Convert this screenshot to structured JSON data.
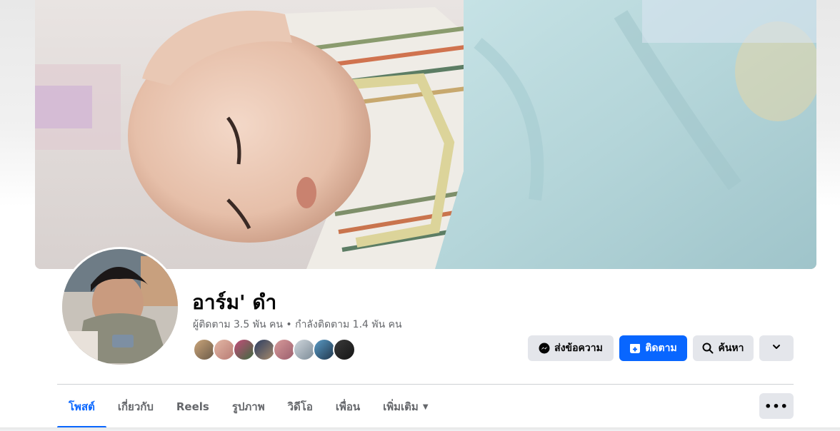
{
  "profile": {
    "name": "อาร์ม' ดำ",
    "followers_text": "ผู้ติดตาม 3.5 พัน คน",
    "separator": " • ",
    "following_text": "กำลังติดตาม 1.4 พัน คน"
  },
  "actions": {
    "message_label": "ส่งข้อความ",
    "follow_label": "ติดตาม",
    "search_label": "ค้นหา"
  },
  "tabs": [
    {
      "label": "โพสต์",
      "active": true
    },
    {
      "label": "เกี่ยวกับ"
    },
    {
      "label": "Reels"
    },
    {
      "label": "รูปภาพ"
    },
    {
      "label": "วิดีโอ"
    },
    {
      "label": "เพื่อน"
    },
    {
      "label": "เพิ่มเติม"
    }
  ],
  "more_menu_label": "•••",
  "colors": {
    "accent": "#0866ff",
    "button_gray": "#e4e6eb",
    "text_primary": "#050505",
    "text_secondary": "#65676b"
  }
}
